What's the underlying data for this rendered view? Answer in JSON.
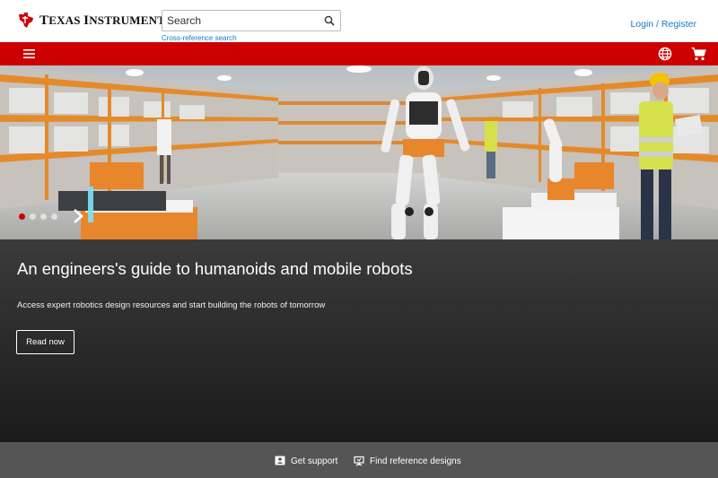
{
  "header": {
    "logo_text_t": "T",
    "logo_text_exas": "EXAS ",
    "logo_text_i": "I",
    "logo_text_nstruments": "NSTRUMENTS",
    "search_placeholder": "Search",
    "cross_reference_label": "Cross-reference search",
    "login_label": "Login / Register"
  },
  "nav": {
    "menu_icon": "hamburger-menu-icon",
    "language_icon": "globe-icon",
    "cart_icon": "shopping-cart-icon",
    "bar_color": "#cc0000"
  },
  "hero": {
    "carousel": {
      "slide_count": 4,
      "active_index": 0
    },
    "title": "An engineers's guide to humanoids and mobile robots",
    "subtitle": "Access expert robotics design resources and start building the robots of tomorrow",
    "cta_label": "Read now"
  },
  "footer_bar": {
    "support_label": "Get support",
    "reference_label": "Find reference designs"
  },
  "colors": {
    "brand_red": "#cc0000",
    "link_blue": "#117ac9",
    "footer_gray": "#555555"
  }
}
